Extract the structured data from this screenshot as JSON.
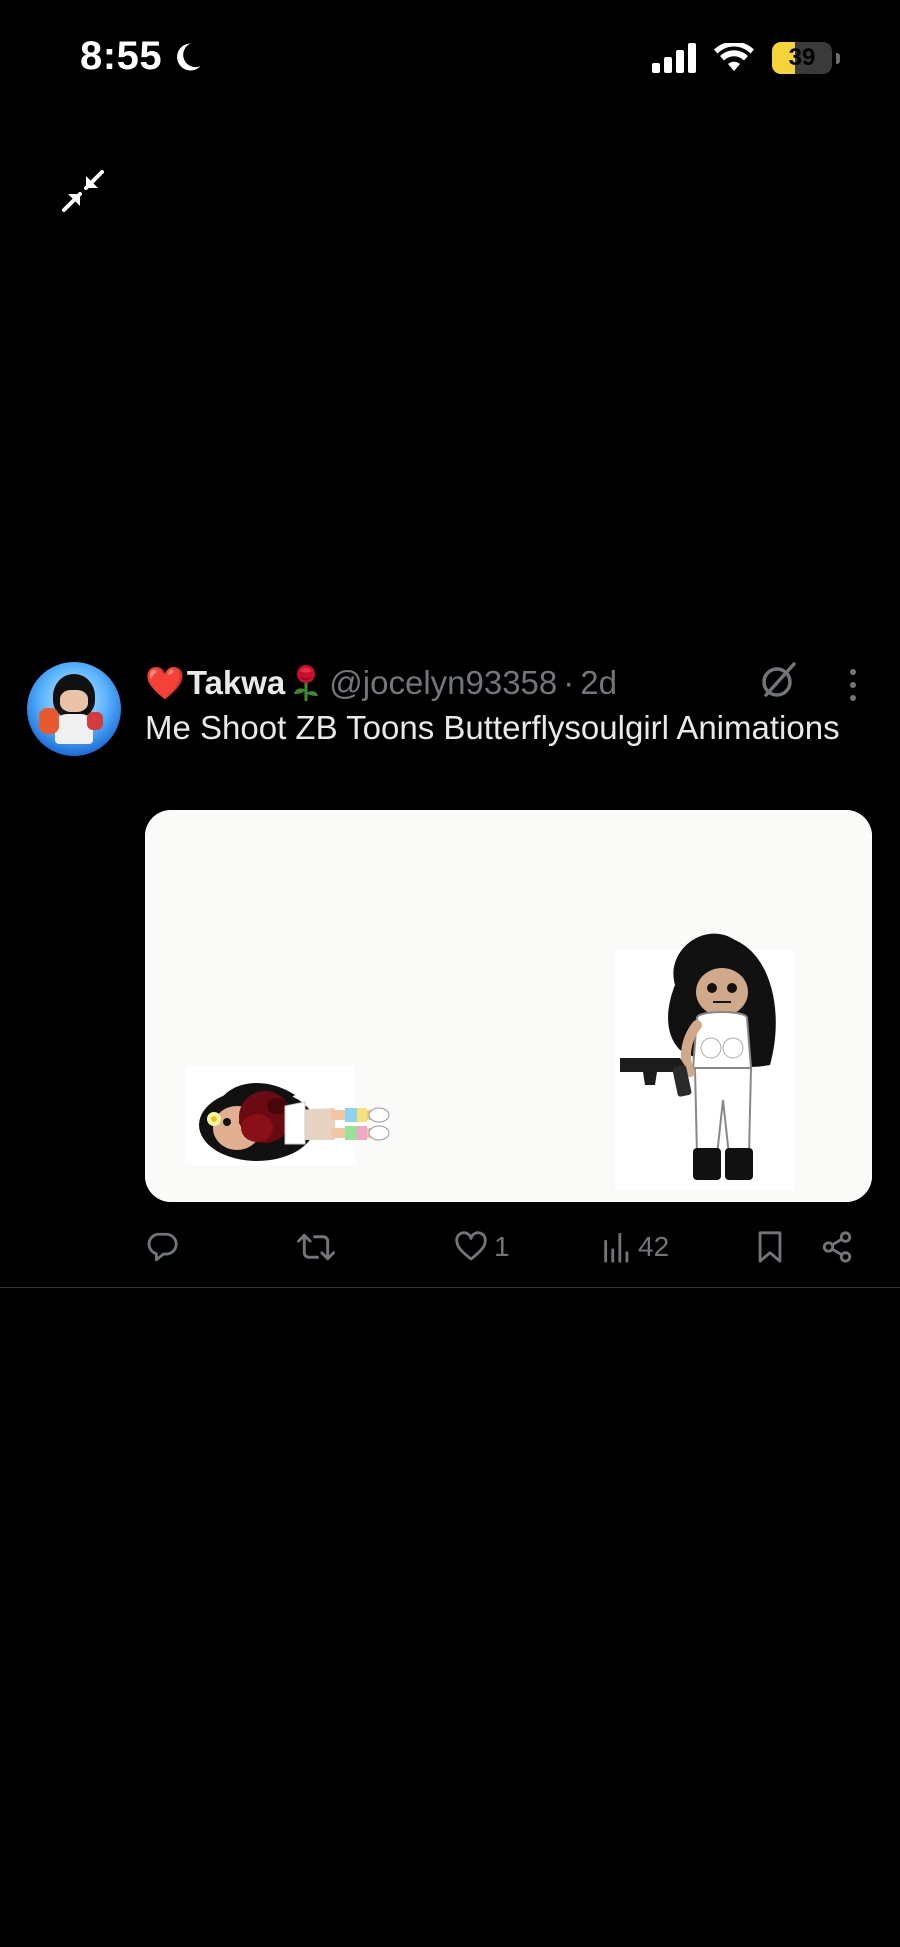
{
  "status_bar": {
    "time": "8:55",
    "battery": "39",
    "battery_level": 0.39
  },
  "tweet": {
    "heart_emoji": "❤️",
    "display_name": "Takwa",
    "handle": "@jocelyn93358",
    "separator": "·",
    "timestamp": "2d",
    "text": "Me Shoot ZB Toons Butterflysoulgirl Animations",
    "actions": {
      "reply_count": "",
      "retweet_count": "",
      "like_count": "1",
      "views_count": "42"
    }
  },
  "colors": {
    "background": "#000000",
    "text_primary": "#e7e9ea",
    "text_secondary": "#71767b",
    "divider": "#2f3336",
    "battery": "#f5d33a"
  },
  "icons": {
    "moon": "moon-icon",
    "signal": "signal-icon",
    "wifi": "wifi-icon",
    "minimize": "minimize-icon",
    "grok": "grok-icon",
    "more": "more-icon",
    "reply": "reply-icon",
    "retweet": "retweet-icon",
    "like": "heart-icon",
    "views": "views-icon",
    "bookmark": "bookmark-icon",
    "share": "share-icon"
  }
}
